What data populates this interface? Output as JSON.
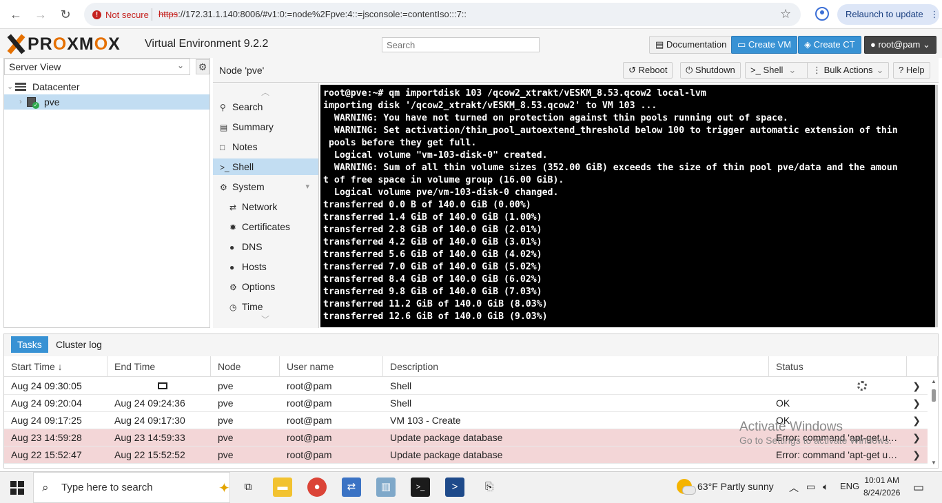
{
  "browser": {
    "security": "Not secure",
    "url_scheme": "https",
    "url_rest": "://172.31.1.140:8006/#v1:0:=node%2Fpve:4::=jsconsole:=contentIso:::7::",
    "relaunch": "Relaunch to update"
  },
  "header": {
    "logo_text_1": "PR",
    "logo_text_o1": "O",
    "logo_text_2": "XM",
    "logo_text_o2": "O",
    "logo_text_3": "X",
    "version": "Virtual Environment 9.2.2",
    "search_placeholder": "Search",
    "documentation": "Documentation",
    "create_vm": "Create VM",
    "create_ct": "Create CT",
    "user": "root@pam"
  },
  "tree": {
    "view": "Server View",
    "datacenter": "Datacenter",
    "node": "pve"
  },
  "node_panel": {
    "title": "Node 'pve'",
    "reboot": "Reboot",
    "shutdown": "Shutdown",
    "shell": "Shell",
    "bulk_actions": "Bulk Actions",
    "help": "Help"
  },
  "menu": [
    {
      "label": "Search",
      "icon": "search-icon",
      "sub": false
    },
    {
      "label": "Summary",
      "icon": "book-icon",
      "sub": false
    },
    {
      "label": "Notes",
      "icon": "note-icon",
      "sub": false
    },
    {
      "label": "Shell",
      "icon": "terminal-icon",
      "sub": false,
      "active": true
    },
    {
      "label": "System",
      "icon": "cogs-icon",
      "sub": false
    },
    {
      "label": "Network",
      "icon": "exchange-icon",
      "sub": true
    },
    {
      "label": "Certificates",
      "icon": "certificate-icon",
      "sub": true
    },
    {
      "label": "DNS",
      "icon": "globe-icon",
      "sub": true
    },
    {
      "label": "Hosts",
      "icon": "globe-icon",
      "sub": true
    },
    {
      "label": "Options",
      "icon": "gear-icon",
      "sub": true
    },
    {
      "label": "Time",
      "icon": "clock-icon",
      "sub": true
    }
  ],
  "terminal": [
    "root@pve:~# qm importdisk 103 /qcow2_xtrakt/vESKM_8.53.qcow2 local-lvm",
    "importing disk '/qcow2_xtrakt/vESKM_8.53.qcow2' to VM 103 ...",
    "  WARNING: You have not turned on protection against thin pools running out of space.",
    "  WARNING: Set activation/thin_pool_autoextend_threshold below 100 to trigger automatic extension of thin",
    " pools before they get full.",
    "  Logical volume \"vm-103-disk-0\" created.",
    "  WARNING: Sum of all thin volume sizes (352.00 GiB) exceeds the size of thin pool pve/data and the amoun",
    "t of free space in volume group (16.00 GiB).",
    "  Logical volume pve/vm-103-disk-0 changed.",
    "transferred 0.0 B of 140.0 GiB (0.00%)",
    "transferred 1.4 GiB of 140.0 GiB (1.00%)",
    "transferred 2.8 GiB of 140.0 GiB (2.01%)",
    "transferred 4.2 GiB of 140.0 GiB (3.01%)",
    "transferred 5.6 GiB of 140.0 GiB (4.02%)",
    "transferred 7.0 GiB of 140.0 GiB (5.02%)",
    "transferred 8.4 GiB of 140.0 GiB (6.02%)",
    "transferred 9.8 GiB of 140.0 GiB (7.03%)",
    "transferred 11.2 GiB of 140.0 GiB (8.03%)",
    "transferred 12.6 GiB of 140.0 GiB (9.03%)"
  ],
  "log": {
    "tabs": [
      "Tasks",
      "Cluster log"
    ],
    "columns": [
      "Start Time ↓",
      "End Time",
      "Node",
      "User name",
      "Description",
      "Status"
    ],
    "rows": [
      {
        "start": "Aug 24 09:30:05",
        "end": "",
        "node": "pve",
        "user": "root@pam",
        "desc": "Shell",
        "status": "",
        "error": false,
        "running": true
      },
      {
        "start": "Aug 24 09:20:04",
        "end": "Aug 24 09:24:36",
        "node": "pve",
        "user": "root@pam",
        "desc": "Shell",
        "status": "OK",
        "error": false
      },
      {
        "start": "Aug 24 09:17:25",
        "end": "Aug 24 09:17:30",
        "node": "pve",
        "user": "root@pam",
        "desc": "VM 103 - Create",
        "status": "OK",
        "error": false
      },
      {
        "start": "Aug 23 14:59:28",
        "end": "Aug 23 14:59:33",
        "node": "pve",
        "user": "root@pam",
        "desc": "Update package database",
        "status": "Error: command 'apt-get upd...",
        "error": true
      },
      {
        "start": "Aug 22 15:52:47",
        "end": "Aug 22 15:52:52",
        "node": "pve",
        "user": "root@pam",
        "desc": "Update package database",
        "status": "Error: command 'apt-get upd...",
        "error": true
      }
    ]
  },
  "watermark": {
    "title": "Activate Windows",
    "sub": "Go to Settings to activate Windows."
  },
  "taskbar": {
    "search_placeholder": "Type here to search",
    "weather": "63°F  Partly sunny",
    "lang": "ENG",
    "time": "10:01 AM",
    "date": "8/24/2026"
  }
}
